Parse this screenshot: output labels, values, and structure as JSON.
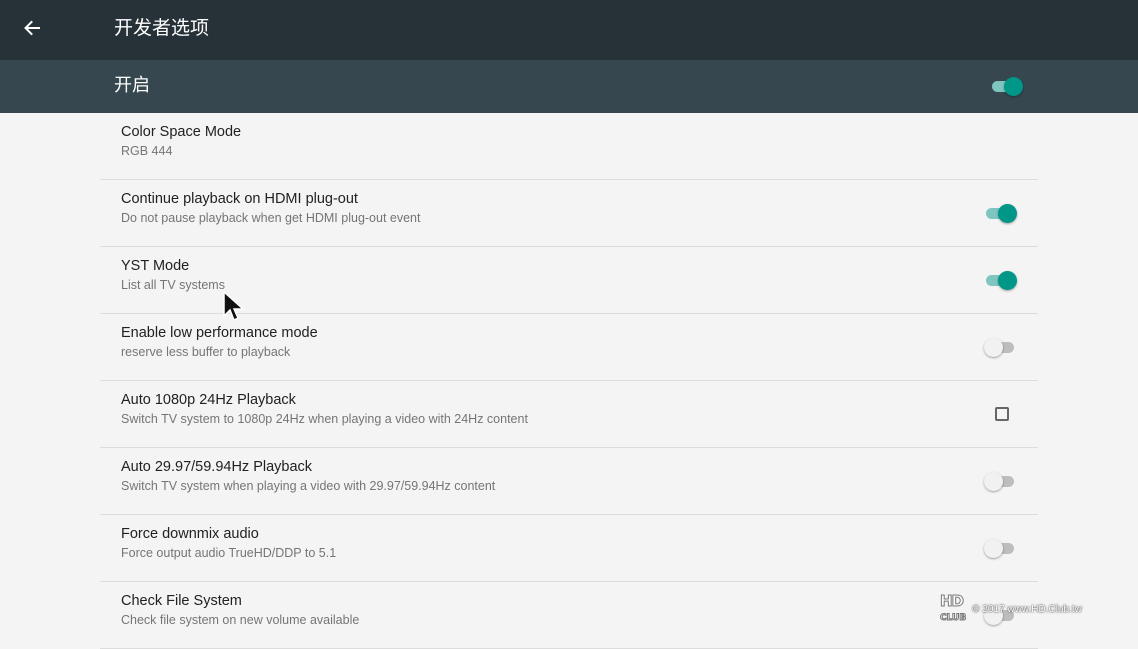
{
  "header": {
    "back_icon": "arrow-left-icon",
    "title": "开发者选项"
  },
  "master": {
    "label": "开启",
    "enabled": true
  },
  "settings": [
    {
      "title": "Color Space Mode",
      "subtitle": "RGB 444",
      "control": "none"
    },
    {
      "title": "Continue playback on HDMI plug-out",
      "subtitle": "Do not pause playback when get HDMI plug-out event",
      "control": "switch",
      "checked": true
    },
    {
      "title": "YST Mode",
      "subtitle": "List all TV systems",
      "control": "switch",
      "checked": true
    },
    {
      "title": "Enable low performance mode",
      "subtitle": "reserve less buffer to playback",
      "control": "switch",
      "checked": false
    },
    {
      "title": "Auto 1080p 24Hz Playback",
      "subtitle": "Switch TV system to 1080p 24Hz when playing a video with 24Hz content",
      "control": "checkbox",
      "checked": false
    },
    {
      "title": "Auto 29.97/59.94Hz Playback",
      "subtitle": "Switch TV system when playing a video with 29.97/59.94Hz content",
      "control": "switch",
      "checked": false
    },
    {
      "title": "Force downmix audio",
      "subtitle": "Force output audio TrueHD/DDP to 5.1",
      "control": "switch",
      "checked": false
    },
    {
      "title": "Check File System",
      "subtitle": "Check file system on new volume available",
      "control": "switch",
      "checked": false
    }
  ],
  "watermark": {
    "logo": "HD CLUB",
    "text": "© 2017 www.HD.Club.tw"
  },
  "colors": {
    "appbar": "#263238",
    "master_bar": "#37474f",
    "accent": "#009688",
    "background": "#f4f4f4"
  }
}
